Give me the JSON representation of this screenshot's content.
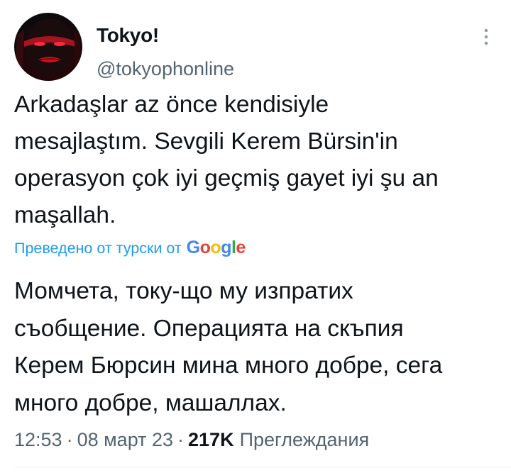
{
  "tweet": {
    "author": {
      "display_name": "Tokyo!",
      "handle": "@tokyophonline"
    },
    "more_icon": "vertical-ellipsis",
    "text": "Arkadaşlar az önce kendisiyle\nmesajlaştım. Sevgili Kerem Bürsin'in\noperasyon çok iyi geçmiş gayet iyi şu an\nmaşallah.",
    "translation": {
      "label": "Преведено от турски от",
      "provider": "Google",
      "text": "Момчета, току-що му изпратих\nсъобщение. Операцията на скъпия\nКерем Бюрсин мина много добре, сега\nмного добре, машаллах."
    },
    "meta": {
      "time": "12:53",
      "separator": "·",
      "date": "08 март 23",
      "views_count": "217K",
      "views_label": "Преглеждания"
    }
  },
  "colors": {
    "accent": "#1d9bf0",
    "text_primary": "#0f1419",
    "text_secondary": "#536471",
    "google_blue": "#4285f4",
    "google_red": "#ea4335",
    "google_yellow": "#fbbc05",
    "google_green": "#34a853"
  }
}
